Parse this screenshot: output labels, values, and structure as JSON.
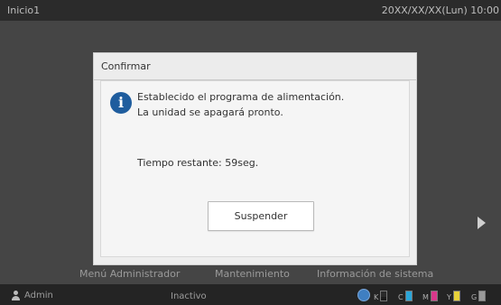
{
  "topbar": {
    "title": "Inicio1",
    "datetime": "20XX/XX/XX(Lun) 10:00"
  },
  "dialog": {
    "title": "Confirmar",
    "message_line1": "Establecido el programa de alimentación.",
    "message_line2": "La unidad se apagará pronto.",
    "remaining": "Tiempo restante: 59seg.",
    "button_label": "Suspender",
    "icon": "info-icon"
  },
  "menu": {
    "admin_menu": "Menú Administrador",
    "maintenance": "Mantenimiento",
    "system_info": "Información de sistema"
  },
  "bottombar": {
    "user": "Admin",
    "status": "Inactivo",
    "inks": [
      {
        "label": "K",
        "color": "#1c1c1c",
        "level": 0.4
      },
      {
        "label": "C",
        "color": "#2aa6d9",
        "level": 1.0
      },
      {
        "label": "M",
        "color": "#d8388a",
        "level": 1.0
      },
      {
        "label": "Y",
        "color": "#e8d23a",
        "level": 1.0
      },
      {
        "label": "G",
        "color": "#9a9a9a",
        "level": 1.0
      }
    ]
  }
}
